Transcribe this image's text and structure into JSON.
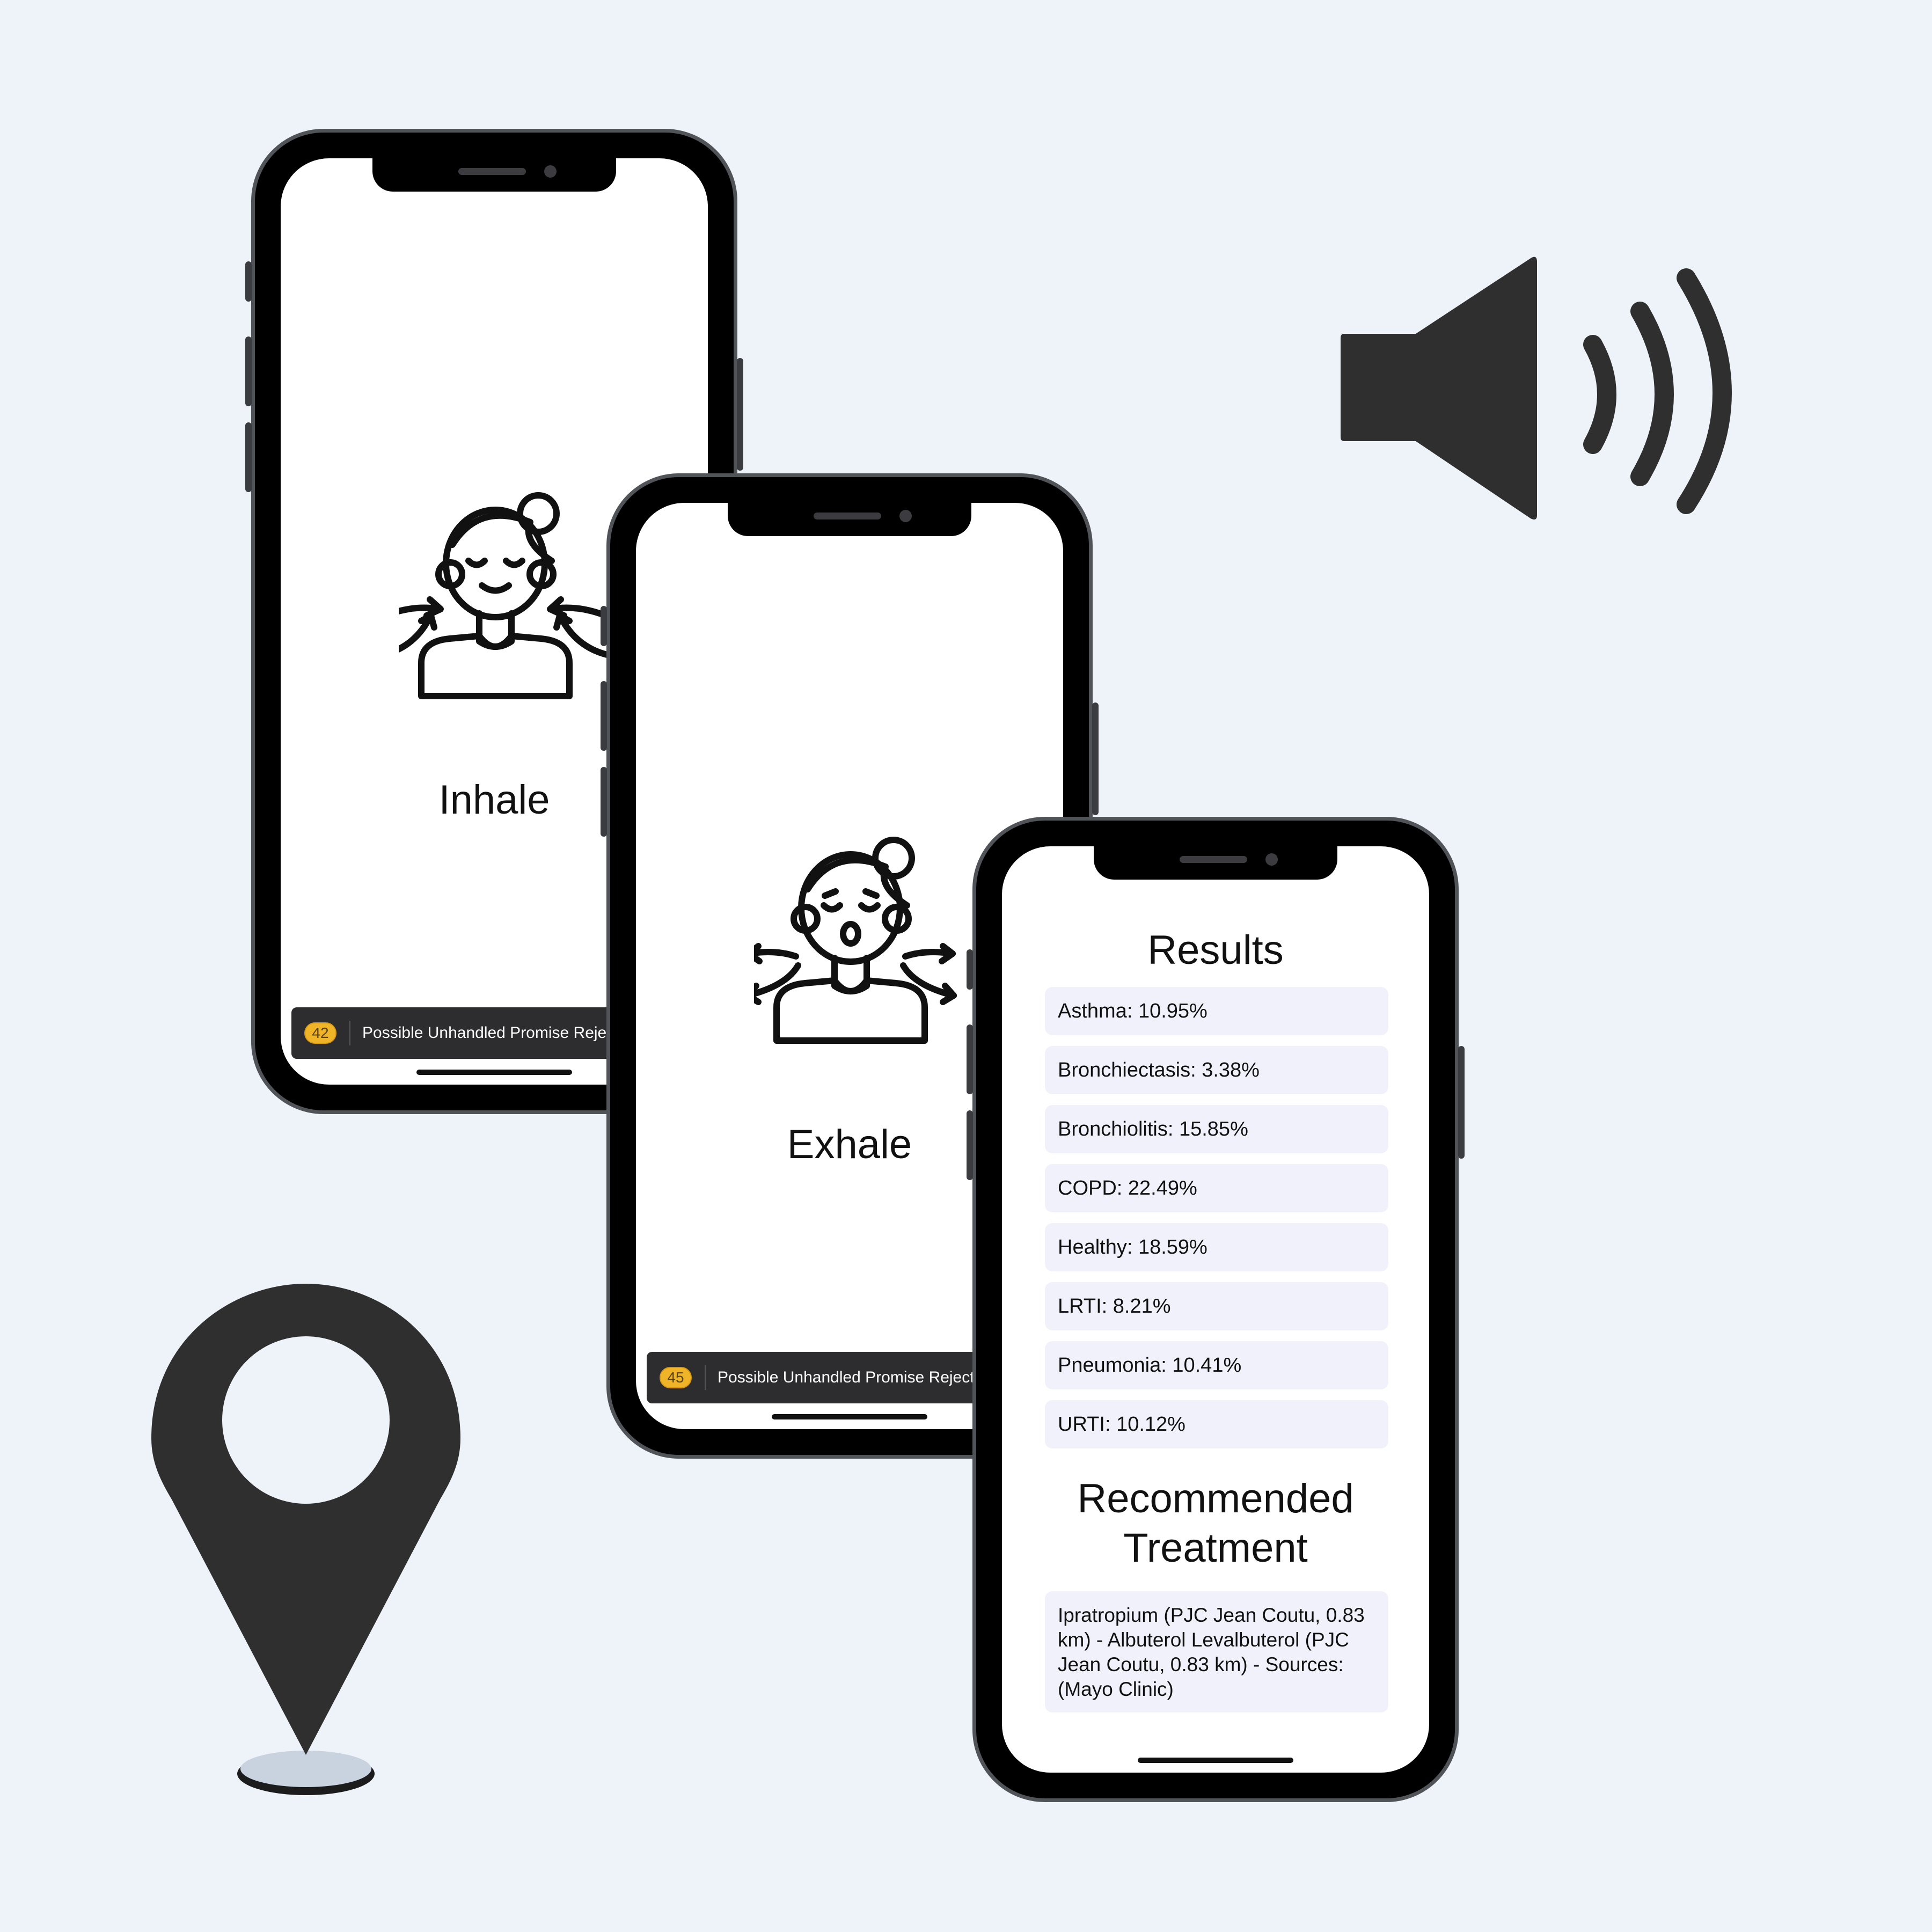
{
  "phones": {
    "inhale": {
      "label": "Inhale",
      "toast": {
        "badge": "42",
        "text": "Possible Unhandled Promise Rejection"
      }
    },
    "exhale": {
      "label": "Exhale",
      "toast": {
        "badge": "45",
        "text": "Possible Unhandled Promise Rejection"
      }
    },
    "results": {
      "title": "Results",
      "items": [
        {
          "label": "Asthma: 10.95%"
        },
        {
          "label": "Bronchiectasis: 3.38%"
        },
        {
          "label": "Bronchiolitis: 15.85%"
        },
        {
          "label": "COPD: 22.49%"
        },
        {
          "label": "Healthy: 18.59%"
        },
        {
          "label": "LRTI: 8.21%"
        },
        {
          "label": "Pneumonia: 10.41%"
        },
        {
          "label": "URTI: 10.12%"
        }
      ],
      "treatment_title": "Recommended Treatment",
      "treatment_text": "Ipratropium (PJC Jean Coutu, 0.83 km) - Albuterol Levalbuterol (PJC Jean Coutu, 0.83 km) -  Sources: (Mayo Clinic)"
    }
  },
  "icons": {
    "speaker": "speaker-volume-icon",
    "location": "location-pin-icon",
    "inhale_person": "person-inhale-icon",
    "exhale_person": "person-exhale-icon"
  },
  "colors": {
    "background": "#eef3fa",
    "icon": "#2f2f2f",
    "toast_badge": "#f0b429",
    "result_row": "#f1f1fb"
  }
}
